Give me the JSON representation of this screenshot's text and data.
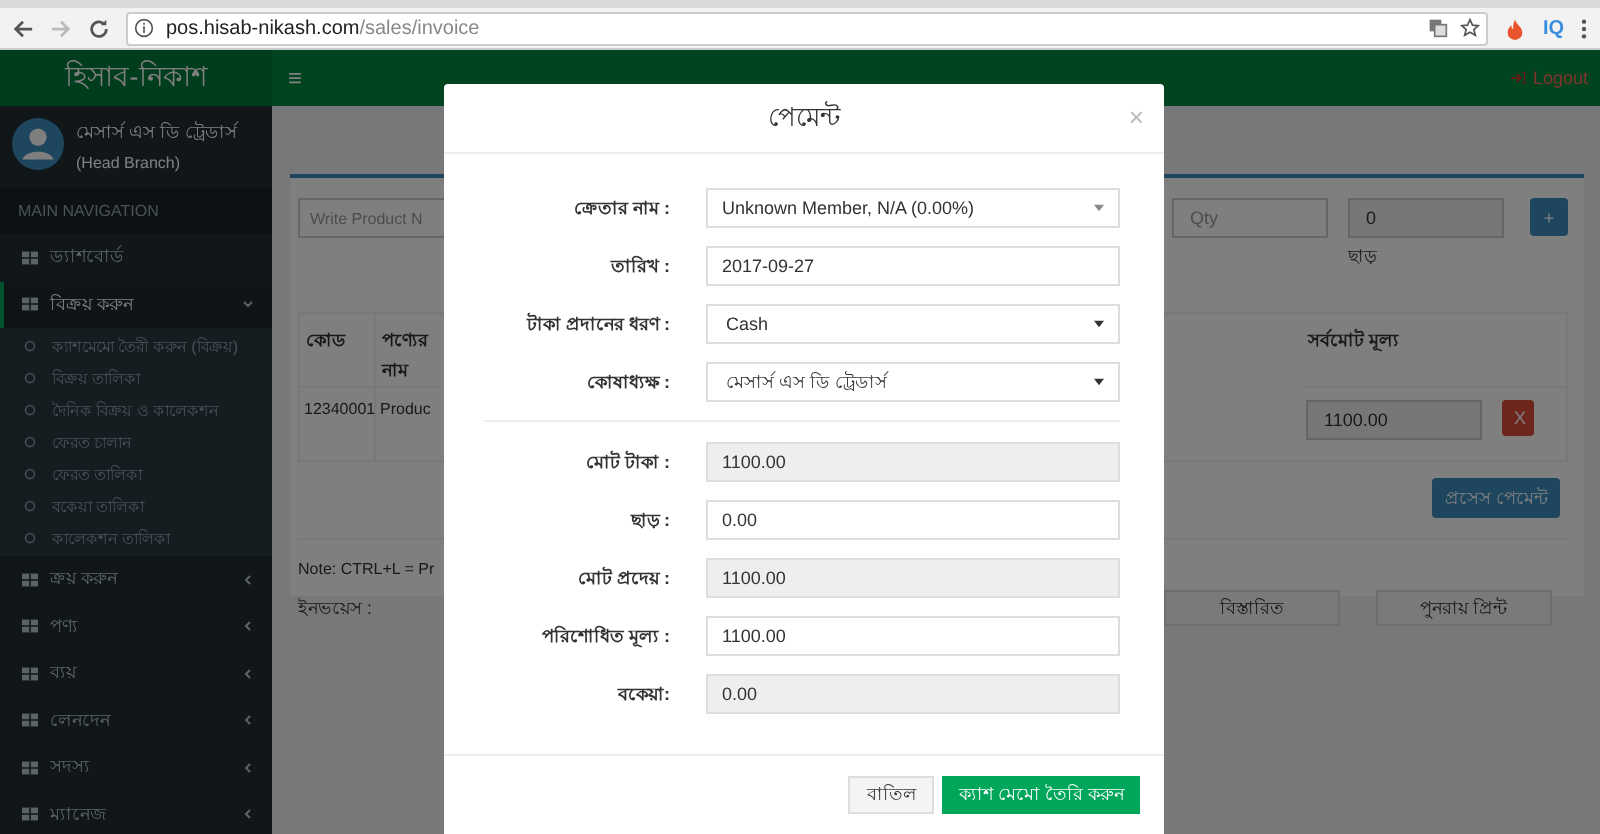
{
  "browser": {
    "url_host": "pos.hisab-nikash.com",
    "url_path": "/sales/invoice",
    "extension_text": "IQ"
  },
  "header": {
    "logo": "হিসাব-নিকাশ",
    "menu_icon": "≡",
    "logout": "Logout"
  },
  "user": {
    "name": "মেসার্স এস ডি ট্রেডার্স",
    "branch": "(Head Branch)"
  },
  "sidebar": {
    "heading": "MAIN NAVIGATION",
    "items": [
      {
        "label": "ড্যাশবোর্ড",
        "kind": "link",
        "selected": false
      },
      {
        "label": "বিক্রয় করুন",
        "kind": "menu",
        "selected": true,
        "expanded": true,
        "children": [
          {
            "label": "ক্যাশমেমো তৈরী করুন (বিক্রয়)"
          },
          {
            "label": "বিক্রয় তালিকা"
          },
          {
            "label": "দৈনিক বিক্রয় ও কালেকশন"
          },
          {
            "label": "ফেরত চালান"
          },
          {
            "label": "ফেরত তালিকা"
          },
          {
            "label": "বকেয়া তালিকা"
          },
          {
            "label": "কালেকশন তালিকা"
          }
        ]
      },
      {
        "label": "ক্রয় করুন",
        "kind": "menu",
        "selected": false,
        "expanded": false
      },
      {
        "label": "পণ্য",
        "kind": "menu",
        "selected": false,
        "expanded": false
      },
      {
        "label": "ব্যয়",
        "kind": "menu",
        "selected": false,
        "expanded": false
      },
      {
        "label": "লেনদেন",
        "kind": "menu",
        "selected": false,
        "expanded": false
      },
      {
        "label": "সদস্য",
        "kind": "menu",
        "selected": false,
        "expanded": false
      },
      {
        "label": "ম্যানেজ",
        "kind": "menu",
        "selected": false,
        "expanded": false
      }
    ]
  },
  "sale_form": {
    "product_placeholder": "Write Product N",
    "qty_placeholder": "Qty",
    "discount_value": "0",
    "discount_label": "ছাড়",
    "add_button": "+"
  },
  "table": {
    "columns": [
      "কোড",
      "পণ্যের নাম",
      "সর্বমোট মূল্য"
    ],
    "rows": [
      {
        "code": "12340001",
        "name": "Produc",
        "total": "1100.00",
        "remove": "X"
      }
    ]
  },
  "process_button": "প্রসেস পেমেন্ট",
  "note": "Note: CTRL+L = Pr",
  "invoice_label": "ইনভয়েস :",
  "invoice_buttons": [
    "বিস্তারিত",
    "পুনরায় প্রিন্ট"
  ],
  "modal": {
    "title": "পেমেন্ট",
    "close": "×",
    "sections": [
      [
        {
          "label": "ক্রেতার নাম :",
          "kind": "combo",
          "value": "Unknown Member, N/A (0.00%)"
        },
        {
          "label": "তারিখ :",
          "kind": "input",
          "value": "2017-09-27"
        },
        {
          "label": "টাকা প্রদানের ধরণ :",
          "kind": "select",
          "value": "Cash"
        },
        {
          "label": "কোষাধ্যক্ষ :",
          "kind": "select",
          "value": "মেসার্স এস ডি ট্রেডার্স"
        }
      ],
      [
        {
          "label": "মোট টাকা :",
          "kind": "readonly",
          "value": "1100.00"
        },
        {
          "label": "ছাড় :",
          "kind": "input",
          "value": "0.00"
        },
        {
          "label": "মোট প্রদেয় :",
          "kind": "readonly",
          "value": "1100.00"
        },
        {
          "label": "পরিশোধিত মূল্য :",
          "kind": "input",
          "value": "1100.00"
        },
        {
          "label": "বকেয়া:",
          "kind": "readonly",
          "value": "0.00"
        }
      ]
    ],
    "cancel_button": "বাতিল",
    "submit_button": "ক্যাশ মেমো তৈরি করুন"
  }
}
